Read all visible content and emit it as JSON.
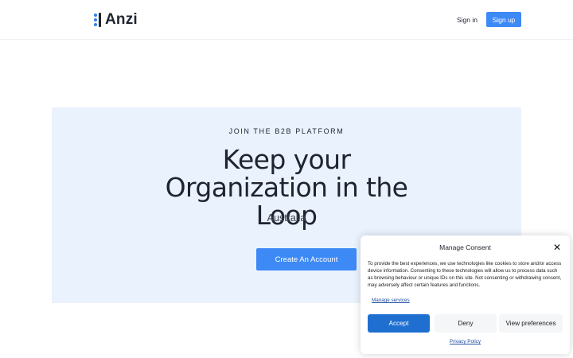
{
  "header": {
    "logo_text": "Anzi",
    "signin_label": "Sign in",
    "signup_label": "Sign up"
  },
  "hero": {
    "eyebrow": "JOIN THE B2B PLATFORM",
    "headline": "Keep your Organization in the Loop",
    "location": "Australia",
    "cta_label": "Create An Account"
  },
  "consent": {
    "title": "Manage Consent",
    "close_glyph": "✕",
    "body": "To provide the best experiences, we use technologies like cookies to store and/or access device information. Consenting to these technologies will allow us to process data such as browsing behaviour or unique IDs on this site. Not consenting or withdrawing consent, may adversely affect certain features and functions.",
    "manage_link": "Manage services",
    "accept_label": "Accept",
    "deny_label": "Deny",
    "preferences_label": "View preferences",
    "privacy_link": "Privacy Policy"
  },
  "colors": {
    "brand_blue": "#3d8af7",
    "accept_blue": "#1e6fd0",
    "hero_bg": "#eaf2fd",
    "text_dark": "#1f2430"
  },
  "icons": {
    "logo": "logo-mark-icon",
    "close": "close-icon"
  }
}
